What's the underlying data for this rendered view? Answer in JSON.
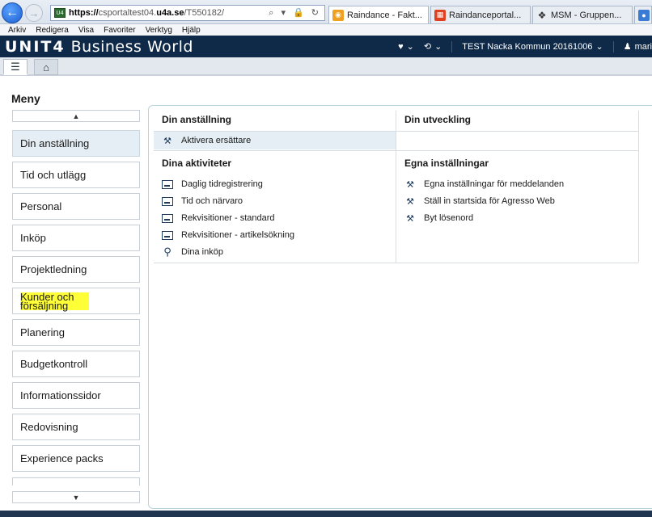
{
  "browser": {
    "address_scheme": "https://",
    "address_host": "csportaltest04.",
    "address_domain": "u4a.se",
    "address_path": "/T550182/",
    "address_controls": "⌕ ▾ 🔒 ↻",
    "site_icon_text": "U4",
    "tabs": [
      {
        "label": "Raindance - Fakt...",
        "icon_color": "#f0a020"
      },
      {
        "label": "Raindanceportal...",
        "icon_color": "#e04020"
      },
      {
        "label": "MSM - Gruppen...",
        "icon_color": "#333333"
      },
      {
        "label": "",
        "icon_color": "#3a7bd5"
      }
    ],
    "menu": [
      "Arkiv",
      "Redigera",
      "Visa",
      "Favoriter",
      "Verktyg",
      "Hjälp"
    ]
  },
  "app": {
    "logo_brand": "UNIT4",
    "logo_product": "Business World",
    "company": "TEST Nacka Kommun 20161006",
    "user": "mari",
    "brand_color": "#0f2a48"
  },
  "toolbar": {
    "menu_icon": "☰",
    "home_icon": "⌂"
  },
  "menu_title": "Meny",
  "sidebar": {
    "items": [
      "Din anställning",
      "Tid och utlägg",
      "Personal",
      "Inköp",
      "Projektledning",
      "Kunder och försäljning",
      "Planering",
      "Budgetkontroll",
      "Informationssidor",
      "Redovisning",
      "Experience packs"
    ],
    "active_index": 0,
    "highlighted_index": 5
  },
  "sections": {
    "din_anstallning": {
      "title": "Din anställning",
      "links": [
        "Aktivera ersättare"
      ]
    },
    "din_utveckling": {
      "title": "Din utveckling",
      "links": []
    },
    "dina_aktiviteter": {
      "title": "Dina aktiviteter",
      "links": [
        "Daglig tidregistrering",
        "Tid och närvaro",
        "Rekvisitioner - standard",
        "Rekvisitioner - artikelsökning",
        "Dina inköp"
      ]
    },
    "egna_installningar": {
      "title": "Egna inställningar",
      "links": [
        "Egna inställningar för meddelanden",
        "Ställ in startsida för Agresso Web",
        "Byt lösenord"
      ]
    }
  }
}
